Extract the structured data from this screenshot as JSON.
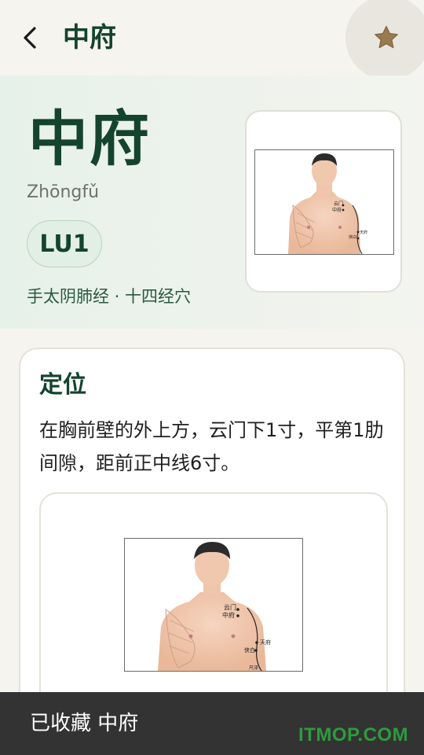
{
  "header": {
    "title": "中府",
    "back_icon": "chevron-left-icon",
    "favorite_icon": "star-icon",
    "favorite_color": "#9a7b4f"
  },
  "acupoint": {
    "name": "中府",
    "pinyin": "Zhōngfǔ",
    "code": "LU1",
    "meridian": "手太阴肺经 · 十四经穴"
  },
  "diagram_labels": {
    "yunmen": "云门",
    "zhongfu": "中府",
    "tianfu": "天府",
    "xiabai": "侠白",
    "chize": "尺泽"
  },
  "location_section": {
    "title": "定位",
    "text": "在胸前壁的外上方，云门下1寸，平第1肋间隙，距前正中线6寸。"
  },
  "snackbar": {
    "text": "已收藏 中府"
  },
  "watermark": "ITMOP.COM",
  "colors": {
    "primary": "#14432e",
    "accent": "#2a5a40",
    "snackbar_bg": "#333333",
    "watermark": "#2e9b3d"
  }
}
